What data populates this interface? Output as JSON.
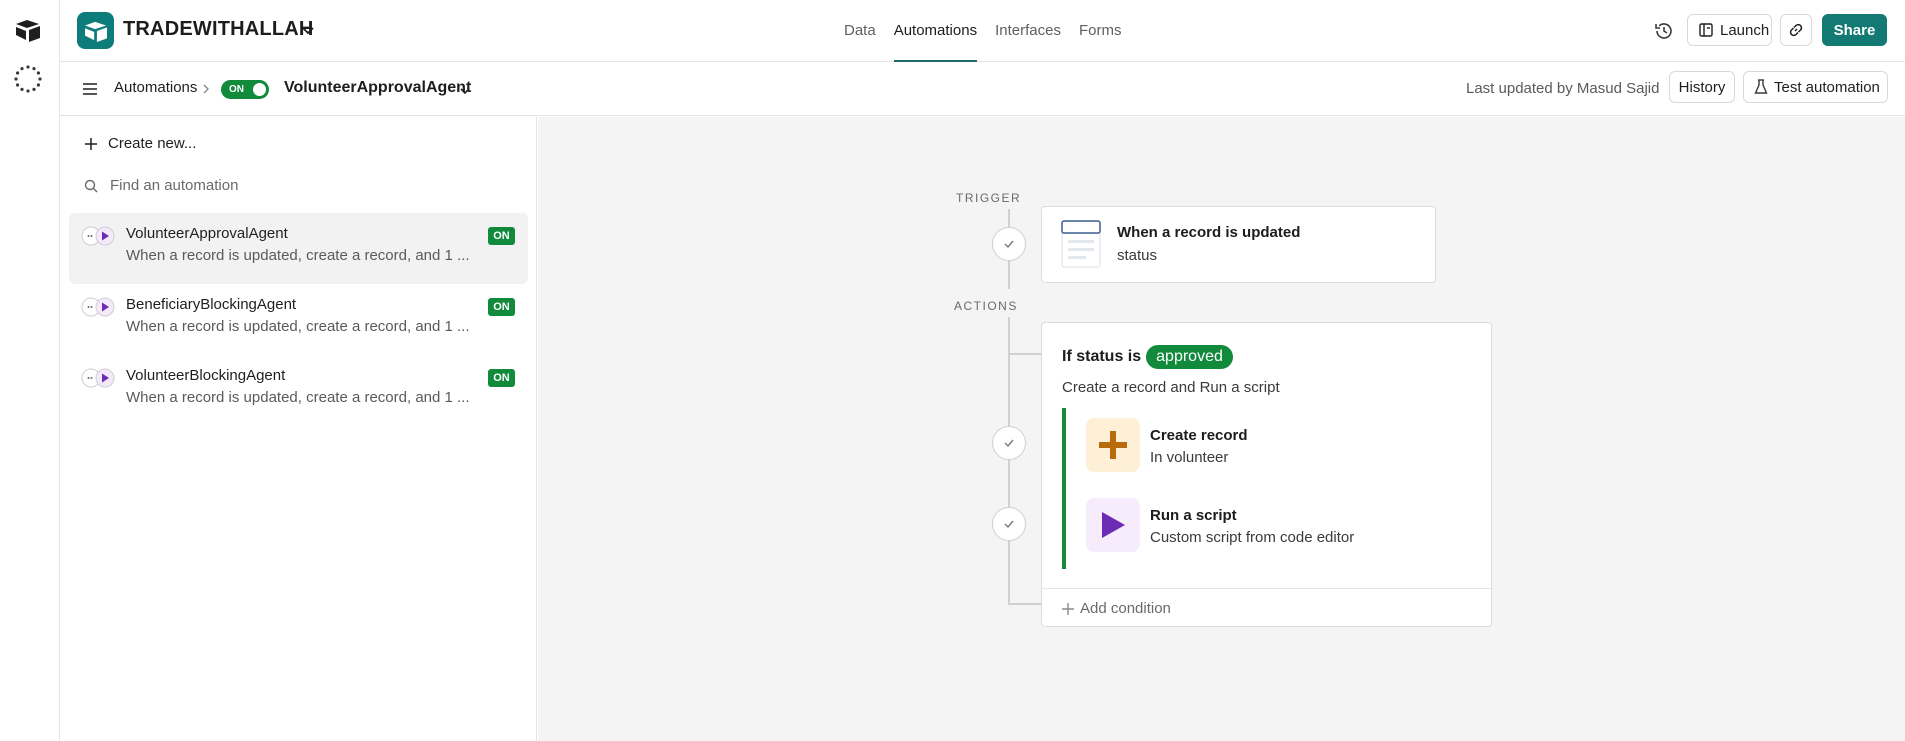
{
  "rail": {
    "logo_icon": "airtable-logo-icon",
    "spinner_icon": "loading-spinner-icon"
  },
  "topbar": {
    "base_name": "TRADEWITHALLAH",
    "tabs": [
      {
        "label": "Data",
        "active": false
      },
      {
        "label": "Automations",
        "active": true
      },
      {
        "label": "Interfaces",
        "active": false
      },
      {
        "label": "Forms",
        "active": false
      }
    ],
    "launch_label": "Launch",
    "share_label": "Share",
    "accent_color": "#127a73"
  },
  "subbar": {
    "breadcrumb": "Automations",
    "toggle_label": "ON",
    "automation_name": "VolunteerApprovalAgent",
    "last_updated": "Last updated by Masud Sajid",
    "history_label": "History",
    "test_label": "Test automation"
  },
  "sidebar": {
    "create_new": "Create new...",
    "find_placeholder": "Find an automation",
    "automations": [
      {
        "name": "VolunteerApprovalAgent",
        "description": "When a record is updated, create a record, and 1 ...",
        "status": "ON",
        "selected": true
      },
      {
        "name": "BeneficiaryBlockingAgent",
        "description": "When a record is updated, create a record, and 1 ...",
        "status": "ON",
        "selected": false
      },
      {
        "name": "VolunteerBlockingAgent",
        "description": "When a record is updated, create a record, and 1 ...",
        "status": "ON",
        "selected": false
      }
    ]
  },
  "canvas": {
    "trigger_label": "TRIGGER",
    "actions_label": "ACTIONS",
    "trigger": {
      "title": "When a record is updated",
      "subtitle": "status"
    },
    "condition": {
      "prefix": "If status is",
      "value": "approved",
      "subtitle": "Create a record and Run a script",
      "actions": [
        {
          "title": "Create record",
          "subtitle": "In volunteer",
          "icon": "plus-icon"
        },
        {
          "title": "Run a script",
          "subtitle": "Custom script from code editor",
          "icon": "play-icon"
        }
      ],
      "add_condition": "Add condition"
    }
  }
}
